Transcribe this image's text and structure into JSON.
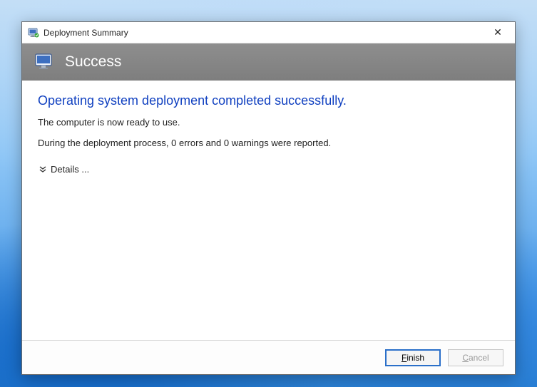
{
  "window": {
    "title": "Deployment Summary",
    "close_glyph": "✕"
  },
  "banner": {
    "title": "Success"
  },
  "content": {
    "headline": "Operating system deployment completed successfully.",
    "ready_text": "The computer is now ready to use.",
    "summary_text": "During the deployment process, 0 errors and 0 warnings were reported.",
    "details_label": "Details ..."
  },
  "footer": {
    "finish_mnemonic": "F",
    "finish_rest": "inish",
    "cancel_mnemonic": "C",
    "cancel_rest": "ancel"
  }
}
